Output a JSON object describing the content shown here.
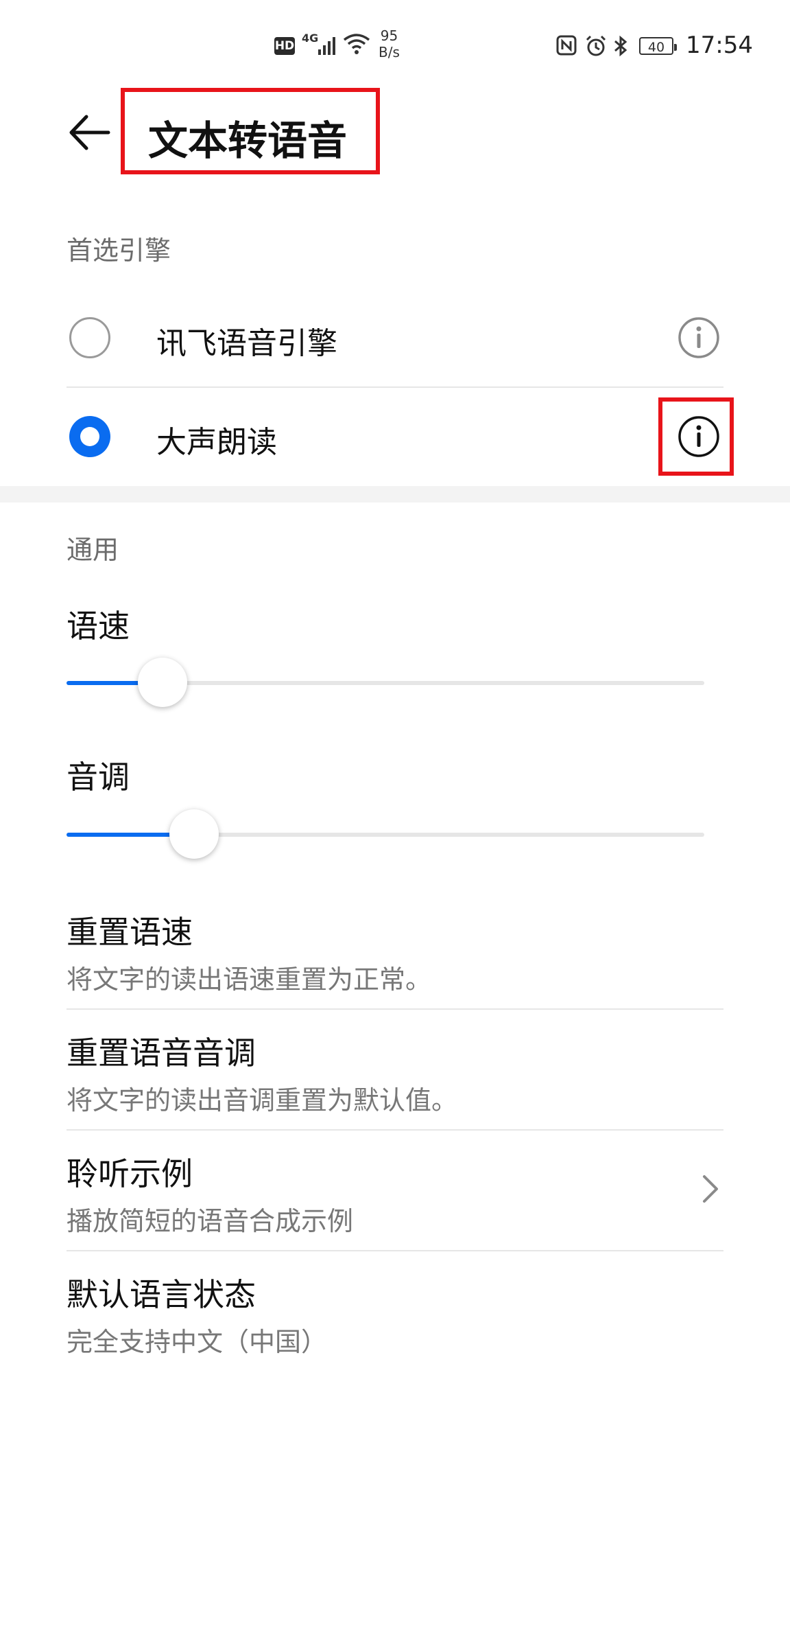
{
  "status_bar": {
    "hd": "HD",
    "network": "4G",
    "speed_value": "95",
    "speed_unit": "B/s",
    "battery": "40",
    "time": "17:54",
    "icons": [
      "hd-icon",
      "signal-icon",
      "wifi-icon",
      "nfc-icon",
      "alarm-icon",
      "bluetooth-icon",
      "battery-icon"
    ]
  },
  "header": {
    "back_icon": "arrow-left-icon",
    "title": "文本转语音"
  },
  "engines": {
    "label": "首选引擎",
    "items": [
      {
        "label": "讯飞语音引擎",
        "selected": false,
        "info_icon": "info-icon"
      },
      {
        "label": "大声朗读",
        "selected": true,
        "info_icon": "info-icon"
      }
    ]
  },
  "general": {
    "label": "通用",
    "speech_rate": {
      "label": "语速",
      "value": 0.15
    },
    "pitch": {
      "label": "音调",
      "value": 0.2
    },
    "items": [
      {
        "title": "重置语速",
        "subtitle": "将文字的读出语速重置为正常。"
      },
      {
        "title": "重置语音音调",
        "subtitle": "将文字的读出音调重置为默认值。"
      },
      {
        "title": "聆听示例",
        "subtitle": "播放简短的语音合成示例",
        "icon": "chevron-right-icon"
      },
      {
        "title": "默认语言状态",
        "subtitle": "完全支持中文（中国）"
      }
    ]
  },
  "colors": {
    "accent": "#0a6cf0",
    "highlight": "#e8141a"
  }
}
